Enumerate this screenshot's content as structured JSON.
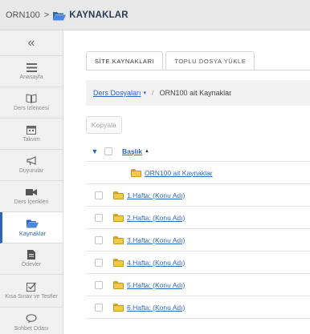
{
  "header": {
    "course": "ORN100",
    "separator": ">",
    "current": "KAYNAKLAR"
  },
  "sidebar": {
    "collapse": "«",
    "items": [
      {
        "label": "Anasayfa",
        "icon": "list-icon"
      },
      {
        "label": "Ders İzlencesi",
        "icon": "book-icon"
      },
      {
        "label": "Takvim",
        "icon": "calendar-icon"
      },
      {
        "label": "Duyurular",
        "icon": "megaphone-icon"
      },
      {
        "label": "Ders İçerikleri",
        "icon": "video-icon"
      },
      {
        "label": "Kaynaklar",
        "icon": "folder-icon",
        "active": true
      },
      {
        "label": "Ödevler",
        "icon": "document-icon"
      },
      {
        "label": "Kısa Sınav ve Testler",
        "icon": "checkbox-icon"
      },
      {
        "label": "Sohbet Odası",
        "icon": "chat-icon"
      }
    ]
  },
  "tabs": [
    {
      "label": "SİTE KAYNAKLARI",
      "active": true
    },
    {
      "label": "TOPLU DOSYA YÜKLE",
      "active": false
    }
  ],
  "breadcrumb": {
    "link": "Ders Dosyaları",
    "caret": "▾",
    "separator": "/",
    "current": "ORN100 ait Kaynaklar"
  },
  "toolbar": {
    "copy_label": "Kopyala"
  },
  "table": {
    "header_title": "Başlık",
    "sort_indicator": "▲",
    "parent_folder": "ORN100 ait Kaynaklar",
    "rows": [
      "1.Hafta: (Konu Adı)",
      "2.Hafta: (Konu Adı)",
      "3.Hafta: (Konu Adı)",
      "4.Hafta: (Konu Adı)",
      "5.Hafta: (Konu Adı)",
      "6.Hafta: (Konu Adı)"
    ]
  },
  "colors": {
    "accent": "#2b66b8",
    "folder": "#f2c94c",
    "brand": "#2b3a55"
  }
}
